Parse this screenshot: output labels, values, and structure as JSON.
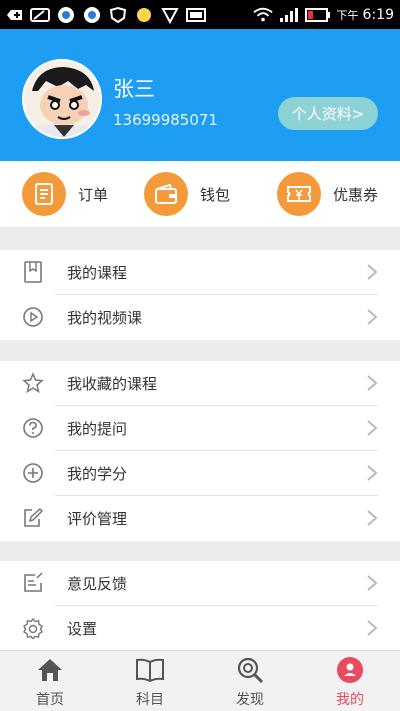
{
  "status_bar": {
    "period": "下午",
    "time": "6:19"
  },
  "profile": {
    "name": "张三",
    "phone": "13699985071",
    "detail_button": "个人资料>"
  },
  "quick_actions": [
    {
      "label": "订单",
      "icon": "order-document-icon"
    },
    {
      "label": "钱包",
      "icon": "wallet-icon"
    },
    {
      "label": "优惠券",
      "icon": "coupon-icon"
    }
  ],
  "menu_groups": [
    [
      {
        "label": "我的课程",
        "icon": "book-icon"
      },
      {
        "label": "我的视频课",
        "icon": "play-circle-icon"
      }
    ],
    [
      {
        "label": "我收藏的课程",
        "icon": "star-icon"
      },
      {
        "label": "我的提问",
        "icon": "question-circle-icon"
      },
      {
        "label": "我的学分",
        "icon": "plus-circle-icon"
      },
      {
        "label": "评价管理",
        "icon": "edit-icon"
      }
    ],
    [
      {
        "label": "意见反馈",
        "icon": "feedback-icon"
      },
      {
        "label": "设置",
        "icon": "gear-icon"
      }
    ]
  ],
  "tabs": [
    {
      "label": "首页",
      "icon": "home-icon",
      "active": false
    },
    {
      "label": "科目",
      "icon": "open-book-icon",
      "active": false
    },
    {
      "label": "发现",
      "icon": "discover-search-icon",
      "active": false
    },
    {
      "label": "我的",
      "icon": "profile-icon",
      "active": true
    }
  ],
  "colors": {
    "header_bg": "#1e9ef2",
    "accent_orange": "#f59a3a",
    "active_tab": "#e84a5f",
    "profile_button": "#8dd3d5"
  }
}
